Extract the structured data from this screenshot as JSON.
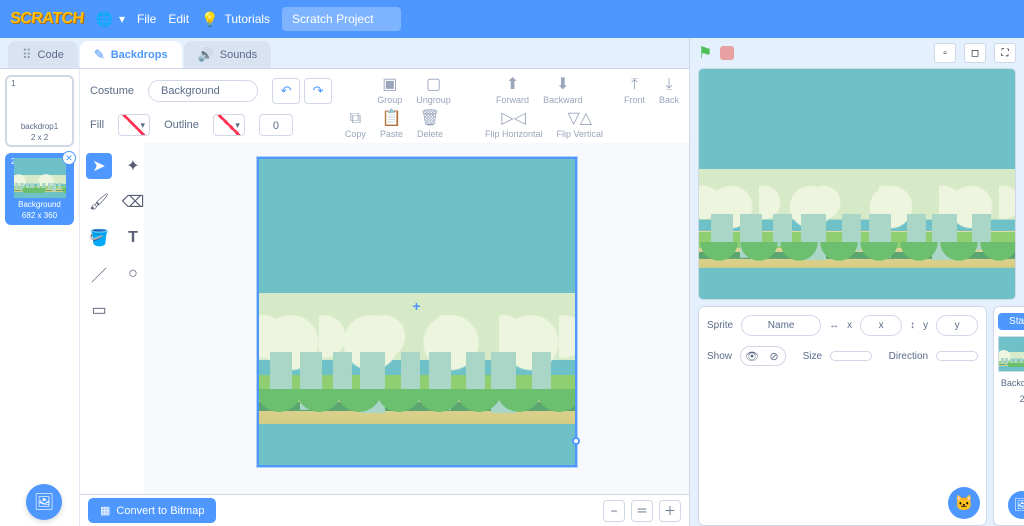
{
  "menu": {
    "file": "File",
    "edit": "Edit",
    "tutorials": "Tutorials",
    "project_title": "Scratch Project"
  },
  "tabs": {
    "code": "Code",
    "backdrops": "Backdrops",
    "sounds": "Sounds"
  },
  "costumes": [
    {
      "index": "1",
      "name": "backdrop1",
      "dims": "2 x 2",
      "selected": false
    },
    {
      "index": "2",
      "name": "Background",
      "dims": "682 x 360",
      "selected": true
    }
  ],
  "paint": {
    "costume_label": "Costume",
    "costume_name": "Background",
    "fill_label": "Fill",
    "outline_label": "Outline",
    "stroke_width": "0",
    "buttons": {
      "group": "Group",
      "ungroup": "Ungroup",
      "forward": "Forward",
      "backward": "Backward",
      "front": "Front",
      "back": "Back",
      "copy": "Copy",
      "paste": "Paste",
      "delete": "Delete",
      "flip_h": "Flip Horizontal",
      "flip_v": "Flip Vertical"
    },
    "convert": "Convert to Bitmap"
  },
  "sprite_info": {
    "sprite_label": "Sprite",
    "name_label": "Name",
    "x_label": "x",
    "y_label": "y",
    "x_value": "x",
    "y_value": "y",
    "show_label": "Show",
    "size_label": "Size",
    "direction_label": "Direction"
  },
  "stage_panel": {
    "header": "Stage",
    "caption": "Backdrops",
    "count": "2"
  }
}
